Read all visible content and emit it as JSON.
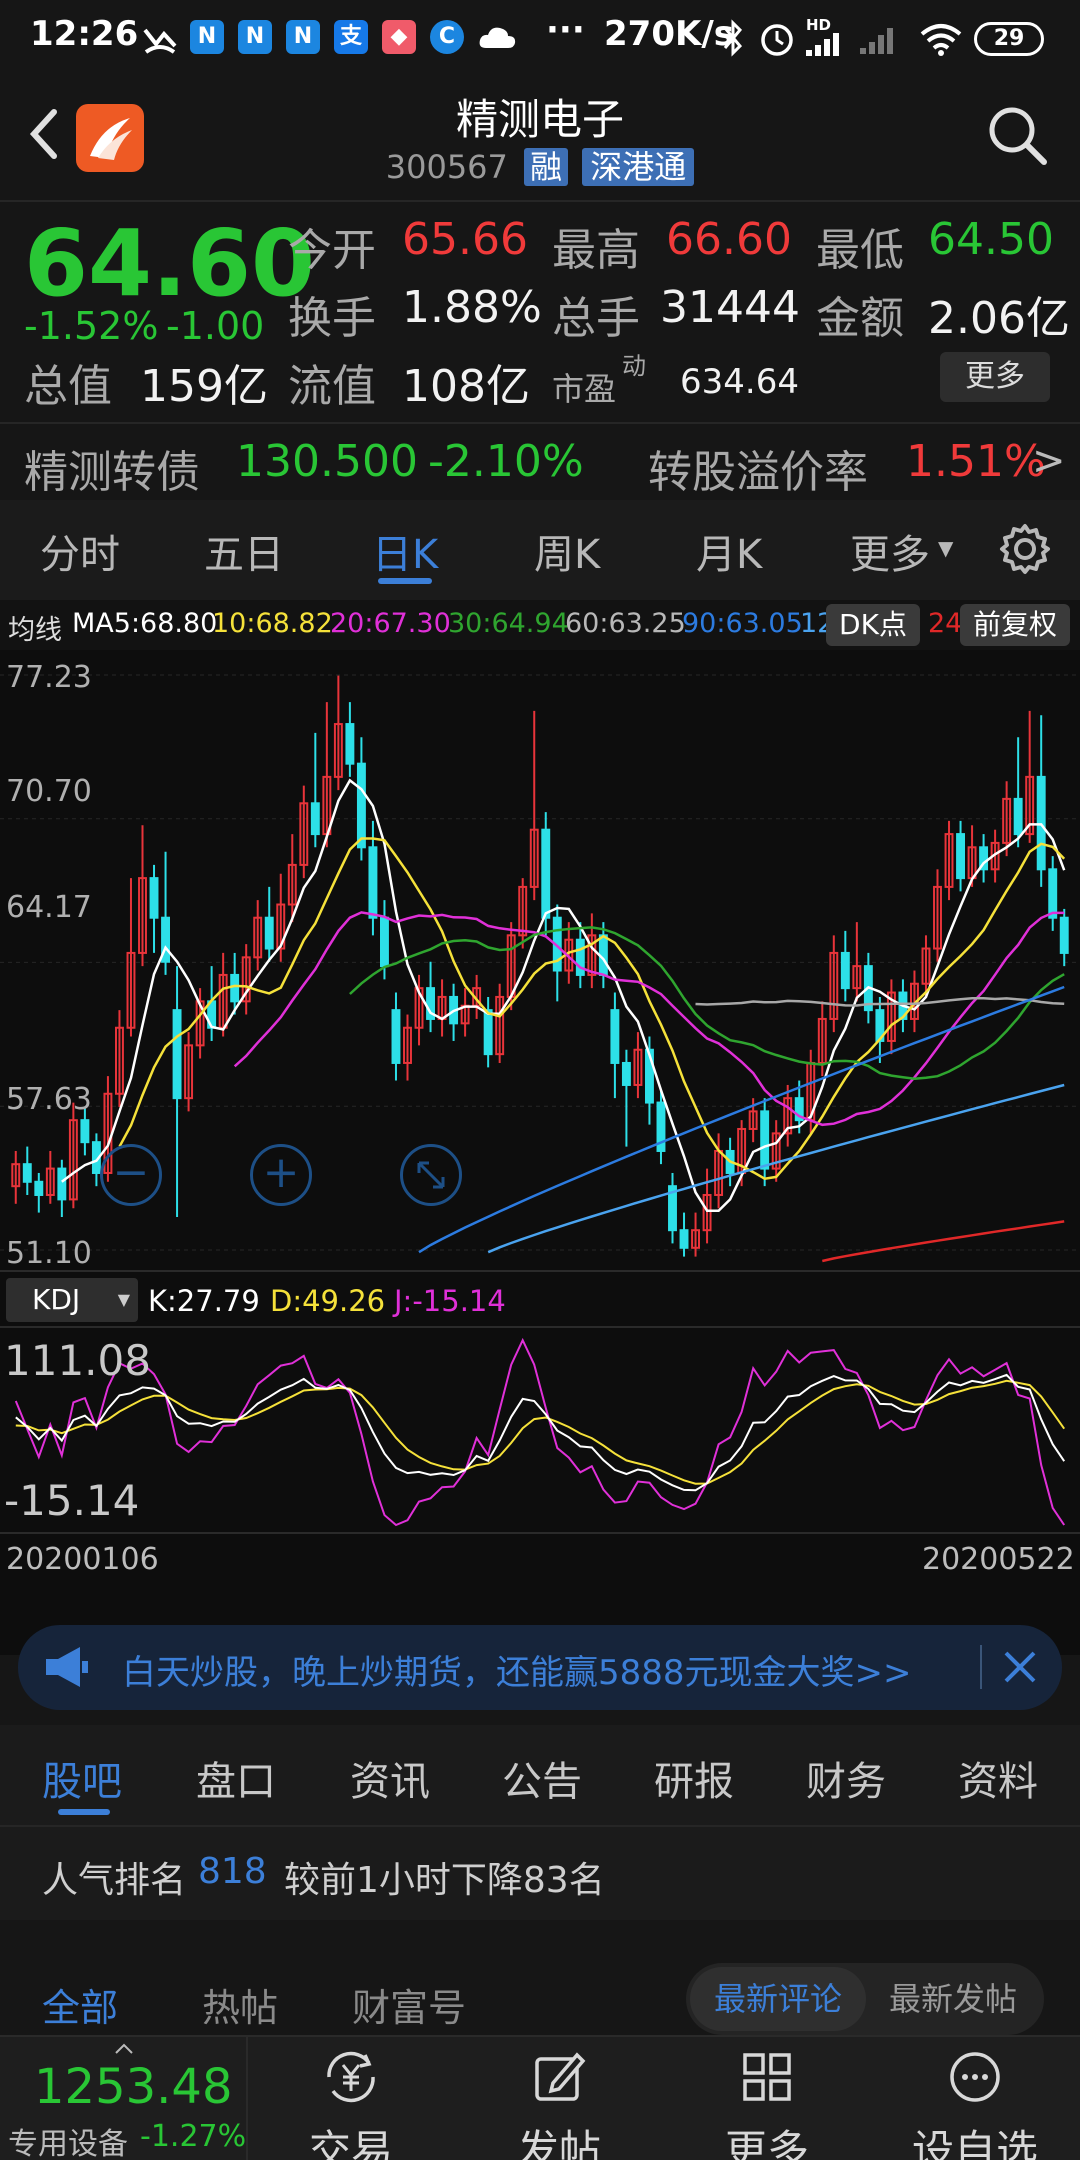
{
  "status": {
    "time": "12:26",
    "speed": "270K/s",
    "battery": "29",
    "hd": "HD"
  },
  "header": {
    "title": "精测电子",
    "code": "300567",
    "tag1": "融",
    "tag2": "深港通"
  },
  "quote": {
    "price": "64.60",
    "change_pct": "-1.52%",
    "change": "-1.00",
    "open_lbl": "今开",
    "open": "65.66",
    "high_lbl": "最高",
    "high": "66.60",
    "low_lbl": "最低",
    "low": "64.50",
    "turnover_lbl": "换手",
    "turnover": "1.88%",
    "vol_lbl": "总手",
    "vol": "31444",
    "amount_lbl": "金额",
    "amount": "2.06亿",
    "mcap_lbl": "总值",
    "mcap": "159亿",
    "float_lbl": "流值",
    "float": "108亿",
    "pe_lbl": "市盈",
    "pe_sup": "动",
    "pe": "634.64",
    "more": "更多"
  },
  "bond": {
    "name": "精测转债",
    "price": "130.500",
    "pct": "-2.10%",
    "premium_lbl": "转股溢价率",
    "premium": "1.51%",
    "arrow": ">"
  },
  "ktabs": [
    "分时",
    "五日",
    "日K",
    "周K",
    "月K",
    "更多"
  ],
  "ma": {
    "label": "均线",
    "ma5": "MA5:68.80",
    "ma10": "10:68.82",
    "ma20": "20:67.30",
    "ma30": "30:64.94",
    "ma60": "60:63.25",
    "ma90": "90:63.05",
    "ma120": "12",
    "ma240": "24",
    "dk": "DK点",
    "fq": "前复权"
  },
  "yaxis": [
    "77.23",
    "70.70",
    "64.17",
    "57.63",
    "51.10"
  ],
  "kdj": {
    "name": "KDJ",
    "k": "K:27.79",
    "d": "D:49.26",
    "j": "J:-15.14",
    "top": "111.08",
    "bottom": "-15.14"
  },
  "dates": {
    "start": "20200106",
    "end": "20200522"
  },
  "banner": {
    "text": "白天炒股，晚上炒期货，还能赢5888元现金大奖>>"
  },
  "bottomtabs": [
    "股吧",
    "盘口",
    "资讯",
    "公告",
    "研报",
    "财务",
    "资料"
  ],
  "popularity": {
    "label": "人气排名",
    "rank": "818",
    "note": "较前1小时下降83名"
  },
  "filter": {
    "all": "全部",
    "hot": "热帖",
    "wealth": "财富号",
    "latest_comment": "最新评论",
    "latest_post": "最新发帖"
  },
  "index": {
    "value": "1253.48",
    "name": "专用设备",
    "pct": "-1.27%"
  },
  "nav": [
    "交易",
    "发帖",
    "更多",
    "设自选"
  ],
  "colors": {
    "up": "#f03a3a",
    "down": "#29c635",
    "accent": "#3c7fd8"
  },
  "chart_data": {
    "type": "candlestick",
    "ylim": [
      51.1,
      77.23
    ],
    "y_ticks": [
      "77.23",
      "70.70",
      "64.17",
      "57.63",
      "51.10"
    ],
    "x_range": [
      "20200106",
      "20200522"
    ],
    "candles": [
      [
        54.0,
        55.0,
        53.2,
        55.6
      ],
      [
        55.0,
        54.2,
        53.6,
        55.8
      ],
      [
        54.2,
        53.6,
        52.8,
        54.6
      ],
      [
        53.6,
        54.8,
        53.2,
        55.6
      ],
      [
        54.8,
        53.4,
        52.6,
        55.2
      ],
      [
        53.4,
        57.0,
        53.0,
        57.8
      ],
      [
        57.0,
        56.0,
        55.4,
        57.6
      ],
      [
        56.0,
        54.6,
        54.0,
        56.4
      ],
      [
        54.6,
        58.2,
        54.2,
        59.0
      ],
      [
        58.2,
        61.2,
        57.6,
        62.0
      ],
      [
        61.2,
        64.6,
        60.8,
        68.0
      ],
      [
        64.6,
        68.0,
        64.0,
        70.4
      ],
      [
        68.0,
        66.2,
        64.6,
        68.6
      ],
      [
        66.2,
        64.2,
        63.6,
        69.2
      ],
      [
        62.0,
        58.0,
        52.6,
        64.0
      ],
      [
        58.0,
        60.4,
        57.4,
        61.0
      ],
      [
        60.4,
        62.4,
        59.8,
        63.0
      ],
      [
        62.4,
        61.2,
        60.6,
        64.0
      ],
      [
        61.2,
        63.6,
        60.8,
        64.6
      ],
      [
        63.6,
        62.4,
        61.8,
        64.6
      ],
      [
        62.4,
        64.4,
        61.8,
        65.0
      ],
      [
        64.4,
        66.2,
        63.8,
        67.0
      ],
      [
        66.2,
        64.8,
        64.2,
        67.6
      ],
      [
        64.8,
        66.8,
        64.2,
        68.2
      ],
      [
        66.8,
        68.6,
        66.0,
        70.0
      ],
      [
        68.6,
        71.4,
        68.0,
        72.2
      ],
      [
        71.4,
        70.0,
        69.4,
        74.6
      ],
      [
        70.0,
        72.6,
        69.4,
        76.0
      ],
      [
        72.6,
        75.0,
        72.0,
        77.2
      ],
      [
        75.0,
        73.2,
        72.6,
        76.0
      ],
      [
        73.2,
        69.4,
        68.8,
        74.4
      ],
      [
        69.4,
        66.2,
        65.4,
        70.6
      ],
      [
        66.2,
        64.0,
        63.4,
        67.0
      ],
      [
        62.0,
        59.6,
        58.8,
        62.8
      ],
      [
        59.6,
        61.2,
        58.8,
        61.8
      ],
      [
        61.2,
        63.0,
        60.4,
        63.6
      ],
      [
        63.0,
        61.6,
        61.0,
        64.2
      ],
      [
        61.6,
        62.6,
        60.8,
        63.4
      ],
      [
        62.6,
        61.4,
        60.6,
        63.2
      ],
      [
        61.4,
        62.2,
        60.8,
        63.0
      ],
      [
        62.2,
        63.0,
        61.6,
        63.6
      ],
      [
        62.0,
        60.0,
        59.4,
        62.6
      ],
      [
        60.0,
        62.6,
        59.6,
        63.2
      ],
      [
        62.6,
        65.4,
        62.0,
        66.0
      ],
      [
        65.4,
        67.6,
        64.8,
        68.0
      ],
      [
        67.6,
        70.2,
        67.0,
        75.6
      ],
      [
        70.2,
        66.2,
        65.4,
        71.0
      ],
      [
        66.2,
        63.8,
        62.4,
        66.8
      ],
      [
        63.8,
        65.2,
        63.2,
        66.0
      ],
      [
        65.2,
        63.6,
        63.0,
        66.0
      ],
      [
        63.6,
        65.4,
        63.0,
        66.4
      ],
      [
        65.4,
        63.6,
        63.0,
        66.0
      ],
      [
        62.0,
        59.6,
        58.0,
        62.8
      ],
      [
        59.6,
        58.6,
        55.8,
        60.2
      ],
      [
        58.6,
        60.2,
        58.0,
        61.0
      ],
      [
        60.2,
        57.8,
        56.8,
        60.8
      ],
      [
        57.8,
        55.6,
        55.0,
        58.4
      ],
      [
        54.0,
        52.0,
        51.4,
        54.6
      ],
      [
        52.0,
        51.2,
        50.8,
        52.8
      ],
      [
        51.2,
        52.0,
        50.8,
        52.8
      ],
      [
        52.0,
        53.6,
        51.4,
        54.8
      ],
      [
        53.6,
        55.6,
        53.0,
        56.4
      ],
      [
        55.6,
        54.6,
        54.0,
        56.2
      ],
      [
        54.6,
        56.6,
        54.0,
        57.0
      ],
      [
        56.6,
        57.4,
        56.0,
        58.0
      ],
      [
        57.4,
        54.8,
        54.0,
        58.0
      ],
      [
        54.8,
        56.4,
        54.2,
        57.0
      ],
      [
        56.4,
        58.0,
        55.8,
        58.6
      ],
      [
        58.0,
        57.0,
        56.4,
        58.8
      ],
      [
        57.0,
        59.6,
        56.4,
        60.2
      ],
      [
        59.6,
        61.6,
        59.0,
        62.4
      ],
      [
        61.6,
        64.6,
        61.0,
        65.4
      ],
      [
        64.6,
        63.0,
        62.4,
        65.6
      ],
      [
        63.0,
        64.0,
        62.4,
        66.0
      ],
      [
        64.0,
        62.0,
        61.4,
        64.6
      ],
      [
        62.0,
        60.6,
        59.6,
        62.6
      ],
      [
        60.6,
        62.8,
        60.0,
        63.4
      ],
      [
        62.8,
        61.6,
        61.0,
        63.4
      ],
      [
        61.6,
        63.2,
        61.0,
        63.8
      ],
      [
        63.2,
        64.8,
        62.6,
        65.4
      ],
      [
        64.8,
        67.6,
        64.2,
        68.4
      ],
      [
        67.6,
        70.0,
        67.0,
        70.6
      ],
      [
        70.0,
        68.0,
        67.4,
        70.6
      ],
      [
        68.0,
        69.4,
        67.6,
        70.4
      ],
      [
        69.4,
        68.4,
        67.8,
        70.0
      ],
      [
        68.4,
        69.6,
        67.8,
        70.2
      ],
      [
        69.6,
        71.6,
        69.0,
        72.4
      ],
      [
        71.6,
        70.0,
        69.4,
        74.4
      ],
      [
        70.0,
        72.6,
        69.6,
        75.6
      ],
      [
        72.6,
        68.4,
        67.6,
        75.4
      ],
      [
        68.4,
        66.2,
        65.6,
        69.0
      ],
      [
        66.2,
        64.6,
        64.0,
        66.6
      ]
    ],
    "series": [
      {
        "name": "MA5",
        "color": "#ffffff"
      },
      {
        "name": "MA10",
        "color": "#f5e13a"
      },
      {
        "name": "MA20",
        "color": "#e030d8"
      },
      {
        "name": "MA30",
        "color": "#2fa52f"
      },
      {
        "name": "MA60",
        "color": "#a8a8a8"
      },
      {
        "name": "MA90",
        "color": "#2c7be0"
      },
      {
        "name": "MA120",
        "color": "#4aa3ef"
      },
      {
        "name": "MA240",
        "color": "#e02828"
      }
    ]
  }
}
